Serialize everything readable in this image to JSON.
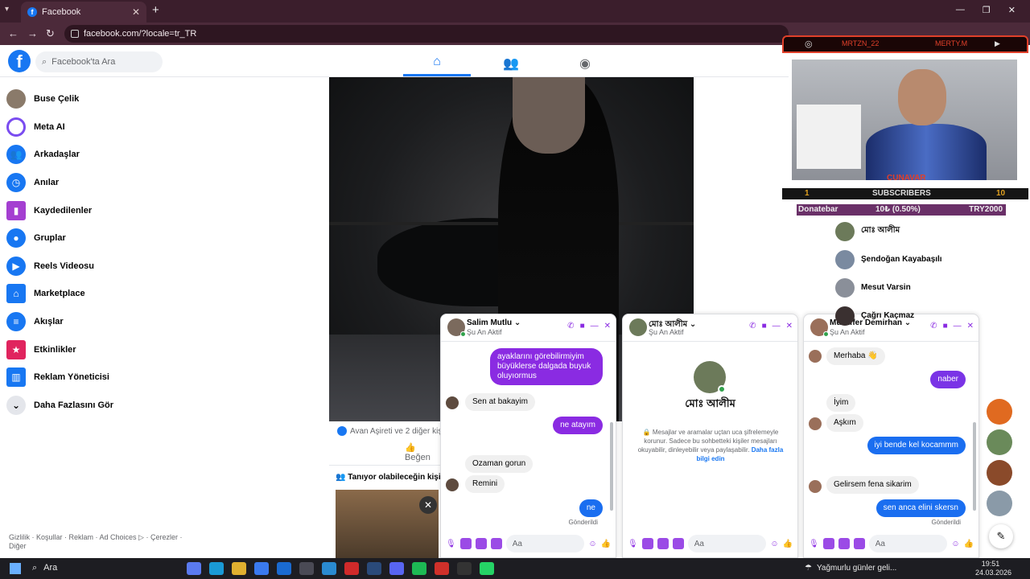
{
  "browser": {
    "tab_title": "Facebook",
    "url": "facebook.com/?locale=tr_TR"
  },
  "header": {
    "search_placeholder": "Facebook'ta Ara"
  },
  "sidebar": {
    "items": [
      {
        "label": "Buse Çelik",
        "icon": "avatar",
        "color": "#8a7a6a"
      },
      {
        "label": "Meta AI",
        "icon": "meta-ai-icon",
        "color": "#7a4cf0"
      },
      {
        "label": "Arkadaşlar",
        "icon": "friends-icon",
        "color": "#1877f2"
      },
      {
        "label": "Anılar",
        "icon": "memories-icon",
        "color": "#1877f2"
      },
      {
        "label": "Kaydedilenler",
        "icon": "saved-icon",
        "color": "#a43fd1"
      },
      {
        "label": "Gruplar",
        "icon": "groups-icon",
        "color": "#1877f2"
      },
      {
        "label": "Reels Videosu",
        "icon": "reels-icon",
        "color": "#1877f2"
      },
      {
        "label": "Marketplace",
        "icon": "marketplace-icon",
        "color": "#1877f2"
      },
      {
        "label": "Akışlar",
        "icon": "feeds-icon",
        "color": "#1877f2"
      },
      {
        "label": "Etkinlikler",
        "icon": "events-icon",
        "color": "#e0245e"
      },
      {
        "label": "Reklam Yöneticisi",
        "icon": "ads-manager-icon",
        "color": "#1877f2"
      },
      {
        "label": "Daha Fazlasını Gör",
        "icon": "chevron-down-icon",
        "color": "#e4e6eb"
      }
    ],
    "footer": "Gizlilik · Koşullar · Reklam · Ad Choices ▷ · Çerezler · Diğer"
  },
  "post": {
    "reactions": "Avan Aşireti ve 2 diğer kişi",
    "like_label": "Beğen",
    "pymk_title": "Tanıyor olabileceğin kişiler"
  },
  "chats": [
    {
      "name": "Salim Mutlu",
      "status": "Şu An Aktif",
      "input_placeholder": "Aa",
      "messages": [
        {
          "dir": "out",
          "text": "ayaklarını görebilirmiyim büyüklerse dalgada buyuk oluyıormus"
        },
        {
          "dir": "in",
          "text": "Sen at bakayim"
        },
        {
          "dir": "out",
          "text": "ne atayım"
        },
        {
          "dir": "in",
          "text": "Ozaman gorun"
        },
        {
          "dir": "in",
          "text": "Remini"
        },
        {
          "dir": "out",
          "text": "ne"
        }
      ],
      "sent_label": "Gönderildi"
    },
    {
      "name": "মোঃ আলীম",
      "status": "Şu An Aktif",
      "input_placeholder": "Aa",
      "e2e_text": "Mesajlar ve aramalar uçtan uca şifrelemeyle korunur. Sadece bu sohbetteki kişiler mesajları okuyabilir, dinleyebilir veya paylaşabilir.",
      "e2e_link": "Daha fazla bilgi edin"
    },
    {
      "name": "Muzaffer Demirhan",
      "status": "Şu An Aktif",
      "input_placeholder": "Aa",
      "messages": [
        {
          "dir": "in",
          "text": "Merhaba 👋"
        },
        {
          "dir": "out",
          "text": "naber"
        },
        {
          "dir": "in",
          "text": "İyim"
        },
        {
          "dir": "in",
          "text": "Aşkım"
        },
        {
          "dir": "out",
          "text": "iyi bende kel kocammm"
        },
        {
          "dir": "in",
          "text": "Gelirsem fena sikarim"
        },
        {
          "dir": "out",
          "text": "sen anca elini skersn"
        }
      ],
      "sent_label": "Gönderildi"
    }
  ],
  "overlay": {
    "name_left": "MRTZN_22",
    "name_right": "MERTY.M",
    "cam_label": "CUNAVAR",
    "subs_current": "1",
    "subs_label": "SUBSCRIBERS",
    "subs_goal": "10",
    "donate_label": "Donatebar",
    "donate_value": "10₺ (0.50%)",
    "donate_goal": "TRY2000"
  },
  "contacts": [
    {
      "name": "মোঃ আলীম"
    },
    {
      "name": "Şendoğan Kayabaşılı"
    },
    {
      "name": "Mesut Varsin"
    },
    {
      "name": "Çağrı Kaçmaz"
    }
  ],
  "taskbar": {
    "search_label": "Ara",
    "weather": "Yağmurlu günler geli...",
    "time": "19:51",
    "date": "24.03.2026"
  }
}
